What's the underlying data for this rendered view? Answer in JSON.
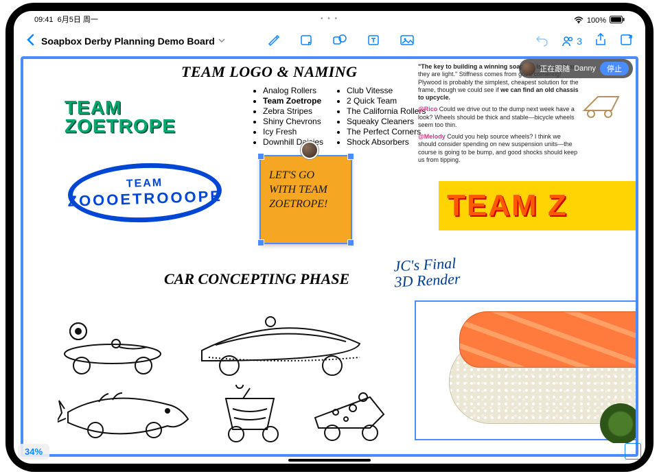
{
  "status": {
    "time": "09:41",
    "date": "6月5日 周一",
    "battery": "100%"
  },
  "toolbar": {
    "title": "Soapbox Derby Planning Demo Board",
    "collab_count": "3"
  },
  "follow": {
    "status": "正在跟随",
    "name": "Danny",
    "stop": "停止"
  },
  "headings": {
    "logo_naming": "TEAM LOGO & NAMING",
    "concepting": "CAR CONCEPTING PHASE",
    "jc_render_l1": "JC's Final",
    "jc_render_l2": "3D Render"
  },
  "logos": {
    "green_l1": "TEAM",
    "green_l2": "ZOETROPE",
    "ring_l1": "TEAM",
    "ring_l2": "ZOOOETROOOPE",
    "orange": "TEAM Z"
  },
  "names_col1": [
    "Analog Rollers",
    "Team Zoetrope",
    "Zebra Stripes",
    "Shiny Chevrons",
    "Icy Fresh",
    "Downhill Daisies"
  ],
  "names_col1_bold_index": 1,
  "names_col2": [
    "Club Vitesse",
    "2 Quick Team",
    "The California Rollers",
    "Squeaky Cleaners",
    "The Perfect Corners",
    "Shock Absorbers"
  ],
  "sticky": {
    "text": "LET'S GO WITH TEAM ZOETROPE!"
  },
  "notes": {
    "intro_bold": "\"The key to building a winning soapbox is…",
    "intro_rest": " as stiff as they are light.\" Stiffness comes from good cornering! Plywood is probably the simplest, cheapest solution for the frame, though we could see if ",
    "intro_bold2": "we can find an old chassis to upcycle.",
    "m1_name": "@Rico",
    "m1_text": " Could we drive out to the dump next week have a look? Wheels should be thick and stable—bicycle wheels seem too thin.",
    "m2_name": "@Melody",
    "m2_text": " Could you help source wheels? I think we should consider spending on new suspension units—the course is going to be bump, and good shocks should keep us from tipping."
  },
  "zoom": "34%"
}
